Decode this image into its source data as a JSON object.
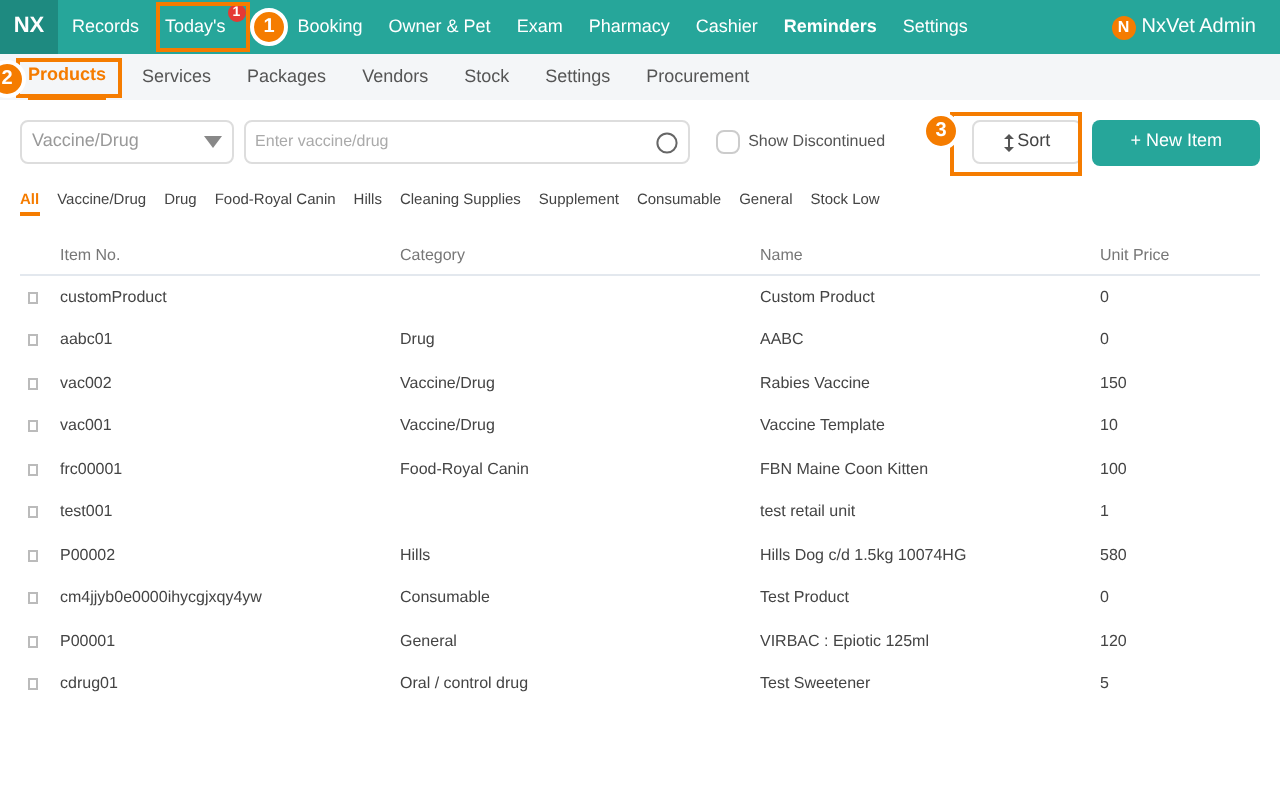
{
  "top_nav": {
    "logo": "NX",
    "items": [
      {
        "label": "Records",
        "selected": false
      },
      {
        "label": "Today's",
        "selected": false,
        "badge": "1"
      },
      {
        "label": "Booking",
        "selected": false
      },
      {
        "label": "Owner & Pet",
        "selected": false
      },
      {
        "label": "Exam",
        "selected": false
      },
      {
        "label": "Pharmacy",
        "selected": false
      },
      {
        "label": "Cashier",
        "selected": false
      },
      {
        "label": "Reminders",
        "selected": true
      },
      {
        "label": "Settings",
        "selected": false
      }
    ],
    "user": {
      "initial": "N",
      "name": "NxVet Admin"
    }
  },
  "sub_nav": [
    {
      "label": "Products",
      "selected": true
    },
    {
      "label": "Services",
      "selected": false
    },
    {
      "label": "Packages",
      "selected": false
    },
    {
      "label": "Vendors",
      "selected": false
    },
    {
      "label": "Stock",
      "selected": false
    },
    {
      "label": "Settings",
      "selected": false
    },
    {
      "label": "Procurement",
      "selected": false
    }
  ],
  "toolbar": {
    "type_select": "Vaccine/Drug",
    "search": {
      "placeholder": "Enter vaccine/drug"
    },
    "show_discontinued": {
      "label": "Show Discontinued",
      "checked": false
    },
    "sort_button": "Sort",
    "new_button": "+ New Item"
  },
  "filters": [
    {
      "label": "All",
      "selected": true
    },
    {
      "label": "Vaccine/Drug",
      "selected": false
    },
    {
      "label": "Drug",
      "selected": false
    },
    {
      "label": "Food-Royal Canin",
      "selected": false
    },
    {
      "label": "Hills",
      "selected": false
    },
    {
      "label": "Cleaning Supplies",
      "selected": false
    },
    {
      "label": "Supplement",
      "selected": false
    },
    {
      "label": "Consumable",
      "selected": false
    },
    {
      "label": "General",
      "selected": false
    },
    {
      "label": "Stock Low",
      "selected": false
    }
  ],
  "table": {
    "columns": [
      "Item No.",
      "Category",
      "Name",
      "Unit Price"
    ],
    "rows": [
      [
        "customProduct",
        "",
        "Custom Product",
        "0"
      ],
      [
        "aabc01",
        "Drug",
        "AABC",
        "0"
      ],
      [
        "vac002",
        "Vaccine/Drug",
        "Rabies Vaccine",
        "150"
      ],
      [
        "vac001",
        "Vaccine/Drug",
        "Vaccine Template",
        "10"
      ],
      [
        "frc00001",
        "Food-Royal Canin",
        "FBN Maine Coon Kitten",
        "100"
      ],
      [
        "test001",
        "",
        "test retail unit",
        "1"
      ],
      [
        "P00002",
        "Hills",
        "Hills Dog c/d 1.5kg 10074HG",
        "580"
      ],
      [
        "cm4jjyb0e0000ihycgjxqy4yw",
        "Consumable",
        "Test Product",
        "0"
      ],
      [
        "P00001",
        "General",
        "VIRBAC : Epiotic 125ml",
        "120"
      ],
      [
        "cdrug01",
        "Oral / control drug",
        "Test Sweetener",
        "5"
      ]
    ]
  },
  "callouts": [
    {
      "number": "1"
    },
    {
      "number": "2"
    },
    {
      "number": "3"
    }
  ]
}
